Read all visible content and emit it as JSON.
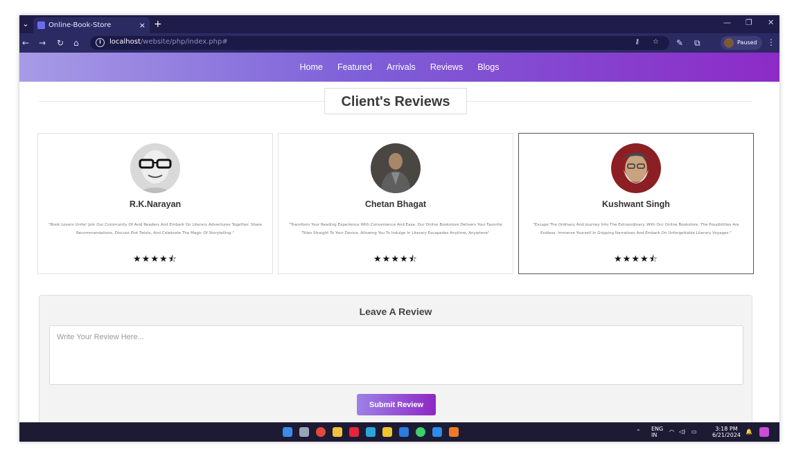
{
  "browser": {
    "tab_title": "Online-Book-Store",
    "tab_close": "×",
    "new_tab": "+",
    "url_host": "localhost",
    "url_path": "/website/php/index.php#",
    "profile_label": "Paused",
    "icons": [
      "back-arrow-icon",
      "forward-arrow-icon",
      "reload-icon",
      "home-icon",
      "site-info-icon",
      "key-icon",
      "star-icon",
      "pen-icon",
      "extensions-icon",
      "menu-icon"
    ]
  },
  "nav": {
    "items": [
      "Home",
      "Featured",
      "Arrivals",
      "Reviews",
      "Blogs"
    ]
  },
  "section": {
    "title": "Client's Reviews"
  },
  "reviews": [
    {
      "name": "R.K.Narayan",
      "text": "\"Book Lovers Unite! Join Our Community Of Avid Readers And Embark On Literary Adventures Together. Share Recommendations, Discuss Plot Twists, And Celebrate The Magic Of Storytelling.\"",
      "rating": 4.5,
      "stars": "★★★★⯪"
    },
    {
      "name": "Chetan Bhagat",
      "text": "\"Transform Your Reading Experience With Convenience And Ease. Our Online Bookstore Delivers Your Favorite Titles Straight To Your Device, Allowing You To Indulge In Literary Escapades Anytime, Anywhere\"",
      "rating": 4.5,
      "stars": "★★★★⯪"
    },
    {
      "name": "Kushwant Singh",
      "text": "\"Escape The Ordinary And Journey Into The Extraordinary. With Our Online Bookstore, The Possibilities Are Endless. Immerse Yourself In Gripping Narratives And Embark On Unforgettable Literary Voyages.\"",
      "rating": 4.5,
      "stars": "★★★★⯪"
    }
  ],
  "leave_review": {
    "title": "Leave A Review",
    "placeholder": "Write Your Review Here...",
    "submit_label": "Submit Review"
  },
  "taskbar": {
    "lang_top": "ENG",
    "lang_bottom": "IN",
    "time": "3:18 PM",
    "date": "6/21/2024"
  },
  "colors": {
    "nav_gradient_start": "#a79be6",
    "nav_gradient_end": "#8d2bc7",
    "browser_dark": "#1f1c4a"
  }
}
